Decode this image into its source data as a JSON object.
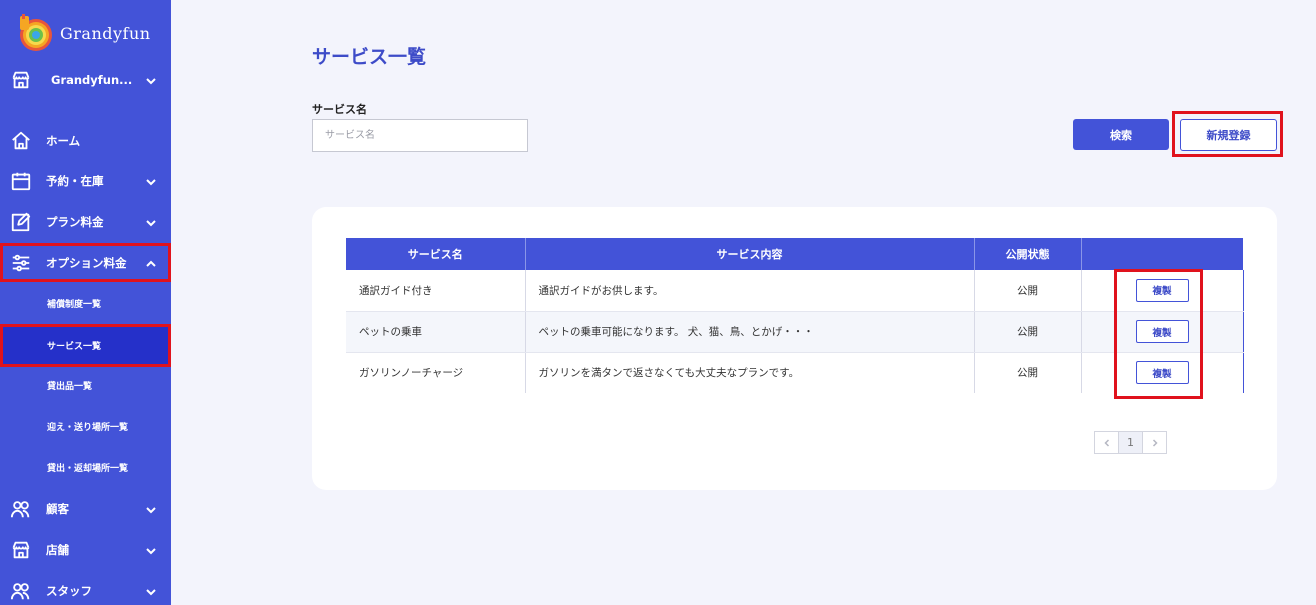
{
  "app": {
    "name": "Grandyfun"
  },
  "sidebar": {
    "store_selector": {
      "label": "Grandyfun..."
    },
    "items": [
      {
        "label": "ホーム",
        "icon": "home-icon"
      },
      {
        "label": "予約・在庫",
        "icon": "calendar-icon"
      },
      {
        "label": "プラン料金",
        "icon": "edit-icon"
      },
      {
        "label": "オプション料金",
        "icon": "sliders-icon"
      },
      {
        "label": "顧客",
        "icon": "users-icon"
      },
      {
        "label": "店舗",
        "icon": "store-icon"
      },
      {
        "label": "スタッフ",
        "icon": "staff-icon"
      }
    ],
    "subitems": [
      {
        "label": "補償制度一覧"
      },
      {
        "label": "サービス一覧"
      },
      {
        "label": "貸出品一覧"
      },
      {
        "label": "迎え・送り場所一覧"
      },
      {
        "label": "貸出・返却場所一覧"
      }
    ]
  },
  "main": {
    "title": "サービス一覧",
    "search": {
      "label": "サービス名",
      "placeholder": "サービス名",
      "value": ""
    },
    "search_button": "検索",
    "new_button": "新規登録",
    "table": {
      "headers": [
        "サービス名",
        "サービス内容",
        "公開状態",
        ""
      ],
      "rows": [
        {
          "name": "通訳ガイド付き",
          "content": "通訳ガイドがお供します。",
          "status": "公開",
          "action": "複製"
        },
        {
          "name": "ペットの乗車",
          "content": "ペットの乗車可能になります。 犬、猫、鳥、とかげ・・・",
          "status": "公開",
          "action": "複製"
        },
        {
          "name": "ガソリンノーチャージ",
          "content": "ガソリンを満タンで返さなくても大丈夫なプランです。",
          "status": "公開",
          "action": "複製"
        }
      ]
    },
    "pagination": {
      "current": "1"
    }
  },
  "colors": {
    "primary": "#4353d8",
    "active_sub": "#2530c9",
    "highlight": "#e0121d",
    "background": "#f3f4fc"
  }
}
